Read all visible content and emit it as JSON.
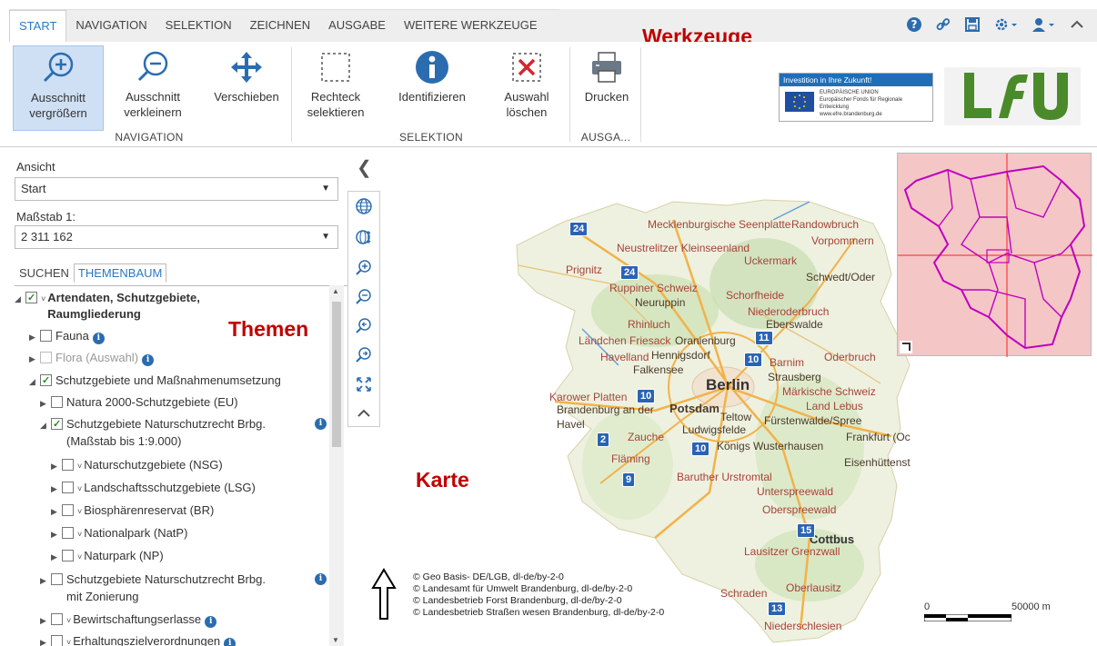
{
  "ribbon_tabs": [
    "START",
    "NAVIGATION",
    "SELEKTION",
    "ZEICHNEN",
    "AUSGABE",
    "WEITERE WERKZEUGE"
  ],
  "annotations": {
    "werkzeuge": "Werkzeuge",
    "themen": "Themen",
    "karte": "Karte"
  },
  "toolbar_icons": [
    "help-icon",
    "link-icon",
    "save-icon",
    "settings-icon",
    "user-icon",
    "collapse-up-icon"
  ],
  "ribbon": {
    "buttons": {
      "zoom_in": "Ausschnitt vergrößern",
      "zoom_out": "Ausschnitt verkleinern",
      "pan": "Verschieben",
      "rect_select": "Rechteck selektieren",
      "identify": "Identifizieren",
      "clear_selection": "Auswahl löschen",
      "print": "Drucken"
    },
    "groups": {
      "navigation": "NAVIGATION",
      "selektion": "SELEKTION",
      "ausgabe": "AUSGA..."
    }
  },
  "eu_banner": {
    "headline": "Investition in Ihre Zukunft!",
    "line1": "EUROPÄISCHE UNION",
    "line2": "Europäischer Fonds für Regionale Entwicklung",
    "line3": "www.efre.brandenburg.de"
  },
  "logo_text": "LfU",
  "left_panel": {
    "ansicht_label": "Ansicht",
    "ansicht_value": "Start",
    "massstab_label": "Maßstab 1:",
    "massstab_value": "2 311 162",
    "tabs": [
      "SUCHEN",
      "THEMENBAUM"
    ],
    "tree": {
      "root": "Artendaten, Schutzgebiete, Raumgliederung",
      "fauna": "Fauna",
      "flora": "Flora (Auswahl)",
      "schutz": "Schutzgebiete und Maßnahmenumsetzung",
      "natura": "Natura 2000-Schutzgebiete (EU)",
      "schutz_brbg": "Schutzgebiete Naturschutzrecht Brbg.",
      "schutz_brbg_scale": "(Maßstab bis 1:9.000)",
      "nsg": "Naturschutzgebiete (NSG)",
      "lsg": "Landschaftsschutzgebiete (LSG)",
      "br": "Biosphärenreservat (BR)",
      "natp": "Nationalpark (NatP)",
      "np": "Naturpark (NP)",
      "zonierung_1": "Schutzgebiete Naturschutzrecht Brbg.",
      "zonierung_2": "mit Zonierung",
      "bewirt": "Bewirtschaftungserlasse",
      "erhalt": "Erhaltungszielverordnungen"
    }
  },
  "map_tools": [
    "globe-icon",
    "globe-arrows-icon",
    "zoom-in-icon",
    "zoom-out-icon",
    "zoom-back-icon",
    "zoom-forward-icon",
    "full-extent-icon",
    "collapse-toolbar-icon"
  ],
  "map": {
    "cities": [
      "Mecklenburgische Seenplatte",
      "Randowbruch",
      "Vorpommern",
      "Neustrelitzer Kleinseenland",
      "Uckermark",
      "Schwedt/Oder",
      "Prignitz",
      "Ruppiner Schweiz",
      "Neuruppin",
      "Schorfheide",
      "Niederoderbruch",
      "Eberswalde",
      "Rhinluch",
      "Ländchen Friesack",
      "Oranienburg",
      "Havelland",
      "Hennigsdorf",
      "Falkensee",
      "Barnim",
      "Oderbruch",
      "Strausberg",
      "Berlin",
      "Märkische Schweiz",
      "Karower Platten",
      "Brandenburg an der",
      "Potsdam",
      "Teltow",
      "Land Lebus",
      "Havel",
      "Fürstenwalde/Spree",
      "Ludwigsfelde",
      "Zauche",
      "Frankfurt (Oc",
      "Fläming",
      "Königs Wusterhausen",
      "Eisenhüttenst",
      "Baruther Urstromtal",
      "Unterspreewald",
      "Oberspreewald",
      "Cottbus",
      "Lausitzer Grenzwall",
      "Schraden",
      "Oberlausitz",
      "Niederschlesien"
    ],
    "highways": [
      "24",
      "24",
      "11",
      "10",
      "10",
      "2",
      "10",
      "9",
      "15",
      "13"
    ],
    "attribution": [
      "© Geo Basis- DE/LGB, dl-de/by-2-0",
      "© Landesamt für Umwelt Brandenburg, dl-de/by-2-0",
      "© Landesbetrieb Forst Brandenburg, dl-de/by-2-0",
      "© Landesbetrieb Straßen wesen Brandenburg, dl-de/by-2-0"
    ],
    "scale_start": "0",
    "scale_end": "50000 m"
  },
  "colors": {
    "accent": "#2b79c2",
    "annotation": "#c00000",
    "eu_blue": "#1f6fb8",
    "lfu_green": "#4a8a2a",
    "minimap_bg": "#f4c6c6",
    "minimap_outline": "#c000c0"
  }
}
